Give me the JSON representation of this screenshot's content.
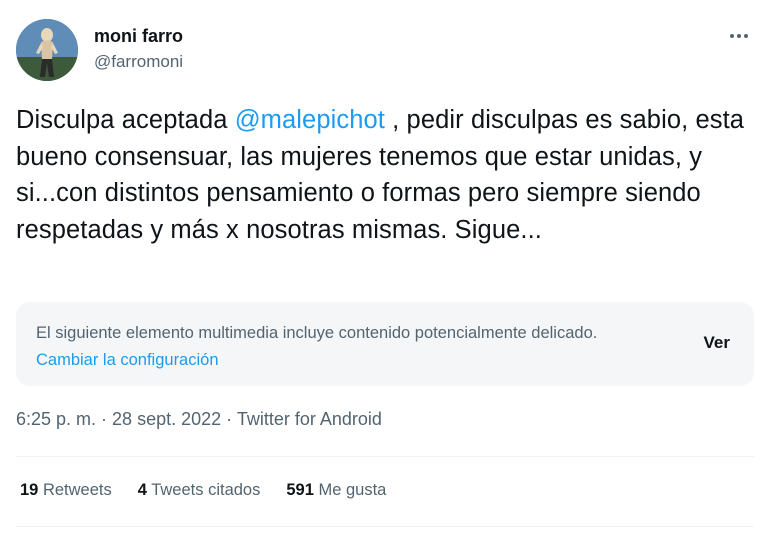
{
  "author": {
    "name": "moni farro",
    "handle": "@farromoni"
  },
  "tweet": {
    "text_before_mention": "Disculpa aceptada ",
    "mention": "@malepichot",
    "text_after_mention": " , pedir disculpas es sabio, esta bueno consensuar, las mujeres tenemos que estar unidas, y si...con distintos pensamiento o formas pero siempre siendo respetadas y más x nosotras mismas. Sigue..."
  },
  "media_warning": {
    "text": "El siguiente elemento multimedia incluye contenido potencialmente delicado.",
    "link": "Cambiar la configuración",
    "button": "Ver"
  },
  "meta": {
    "time": "6:25 p. m.",
    "separator": " · ",
    "date": "28 sept. 2022",
    "source": "Twitter for Android"
  },
  "stats": {
    "retweets_count": "19",
    "retweets_label": "Retweets",
    "quotes_count": "4",
    "quotes_label": "Tweets citados",
    "likes_count": "591",
    "likes_label": "Me gusta"
  },
  "colors": {
    "accent": "#1d9bf0",
    "secondary_text": "#536471",
    "primary_text": "#0f1419",
    "warning_bg": "#f4f6f8"
  },
  "icons": {
    "more": "more-horizontal-icon",
    "avatar": "avatar"
  }
}
